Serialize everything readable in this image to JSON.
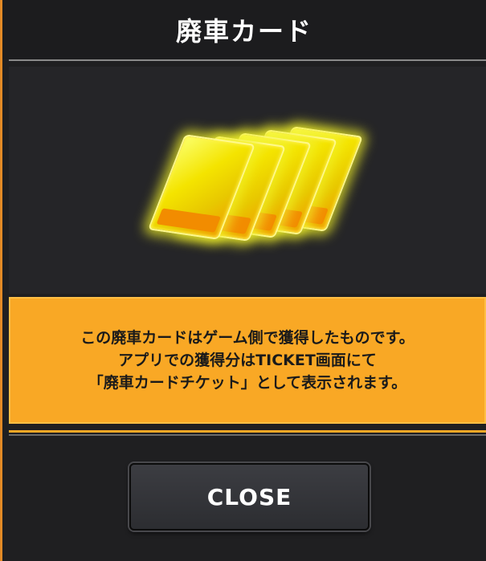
{
  "dialog": {
    "title": "廃車カード",
    "item_icon": "scrap-card-bundle-icon",
    "info_lines": [
      "この廃車カードはゲーム側で獲得したものです。",
      "アプリでの獲得分はTICKET画面にて",
      "「廃車カードチケット」として表示されます。"
    ],
    "close_label": "CLOSE"
  },
  "colors": {
    "accent": "#f9a825",
    "panel": "#1f1f21",
    "card_yellow": "#f4e400"
  }
}
